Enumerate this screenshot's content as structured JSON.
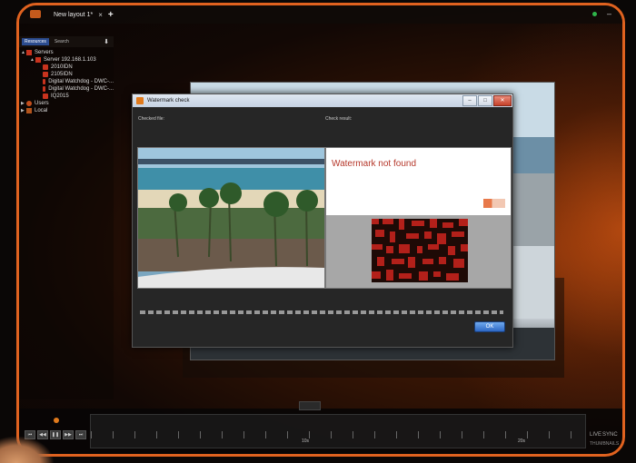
{
  "tabbar": {
    "tab_title": "New layout 1*",
    "close_glyph": "×",
    "add_glyph": "+",
    "minimize_glyph": "–",
    "status_color": "#2fb54a"
  },
  "resources": {
    "tab_label": "Resources",
    "search_placeholder": "Search",
    "download_icon": "download-icon",
    "servers_label": "Servers",
    "server_name": "Server 192.168.1.103",
    "cameras": [
      "2010IDN",
      "2105IDN",
      "Digital Watchdog - DWC-...",
      "Digital Watchdog - DWC-...",
      "IQ2015"
    ],
    "users_label": "Users",
    "local_label": "Local"
  },
  "dialog": {
    "title": "Watermark check",
    "checked_file_label": "Checked file:",
    "check_result_label": "Check result:",
    "result_text": "Watermark not found",
    "ok_label": "OK",
    "min_glyph": "–",
    "max_glyph": "□",
    "close_glyph": "✕"
  },
  "timeline": {
    "labels": [
      "10s",
      "20s"
    ],
    "live_label": "LIVE",
    "sync_label": "SYNC",
    "thumbnails_label": "THUMBNAILS"
  },
  "colors": {
    "accent": "#e0621f",
    "result_text": "#b5372a",
    "ok_button": "#2d67c4"
  }
}
